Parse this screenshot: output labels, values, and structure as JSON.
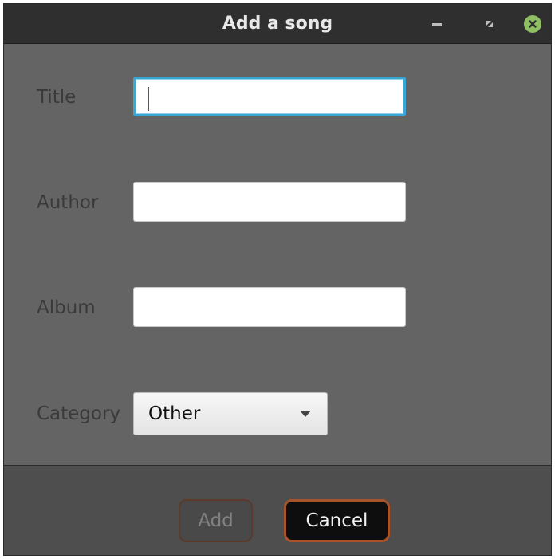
{
  "window": {
    "title": "Add a song",
    "controls": {
      "minimize_icon": "minimize-icon",
      "restore_icon": "restore-icon",
      "close_icon": "close-icon"
    }
  },
  "form": {
    "title_label": "Title",
    "title_value": "",
    "author_label": "Author",
    "author_value": "",
    "album_label": "Album",
    "album_value": "",
    "category_label": "Category",
    "category_selected": "Other"
  },
  "buttons": {
    "add_label": "Add",
    "add_enabled": false,
    "cancel_label": "Cancel"
  },
  "colors": {
    "focus_ring": "#3aa6d6",
    "close_button": "#8fbf63",
    "button_border_accent": "#a8542a"
  }
}
